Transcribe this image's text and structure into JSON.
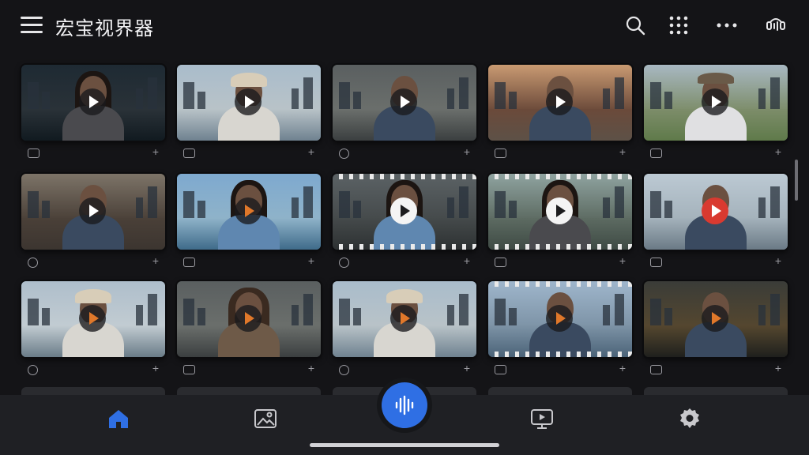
{
  "app": {
    "title": "宏宝视界器"
  },
  "header": {
    "icons": [
      "menu-icon",
      "search-icon",
      "apps-grid-icon",
      "more-icon",
      "voice-assistant-icon"
    ]
  },
  "grid": {
    "rows": [
      [
        {
          "scene": "dark-city",
          "person": "long-hair-woman",
          "play": "dark",
          "meta_icon": "square",
          "action": "+"
        },
        {
          "scene": "cloudy-harbor",
          "person": "bucket-hat-man",
          "play": "dark",
          "meta_icon": "square",
          "action": "+"
        },
        {
          "scene": "office-interior",
          "person": "man",
          "play": "dark",
          "meta_icon": "round",
          "action": "+"
        },
        {
          "scene": "sunset-city",
          "person": "man",
          "play": "dark",
          "meta_icon": "square",
          "action": "+"
        },
        {
          "scene": "green-hills",
          "person": "cap-man",
          "play": "dark",
          "meta_icon": "square",
          "action": "+"
        }
      ],
      [
        {
          "scene": "old-street",
          "person": "man",
          "play": "dark",
          "meta_icon": "round",
          "action": "+"
        },
        {
          "scene": "sky-city",
          "person": "woman",
          "play": "dark-orange",
          "meta_icon": "square",
          "action": "+"
        },
        {
          "scene": "film-dark",
          "person": "woman",
          "play": "white",
          "meta_icon": "round",
          "action": "+"
        },
        {
          "scene": "film-green",
          "person": "long-hair-woman",
          "play": "white",
          "meta_icon": "square",
          "action": "+"
        },
        {
          "scene": "skyline",
          "person": "man",
          "play": "red",
          "meta_icon": "square",
          "action": "+"
        }
      ],
      [
        {
          "scene": "bay-city",
          "person": "bucket-hat-man",
          "play": "dark-orange",
          "meta_icon": "round",
          "action": "+"
        },
        {
          "scene": "office-interior",
          "person": "curly-woman",
          "play": "dark-orange",
          "meta_icon": "square",
          "action": "+"
        },
        {
          "scene": "cloudy-harbor",
          "person": "bucket-hat-man",
          "play": "dark-orange",
          "meta_icon": "round",
          "action": "+"
        },
        {
          "scene": "skyline-film",
          "person": "man",
          "play": "dark-orange",
          "meta_icon": "square",
          "action": "+"
        },
        {
          "scene": "night-street",
          "person": "man",
          "play": "dark-orange",
          "meta_icon": "square",
          "action": "+"
        }
      ]
    ]
  },
  "bottom_nav": {
    "items": [
      "home-icon",
      "gallery-icon",
      "voice-wave-icon",
      "tv-cast-icon",
      "settings-icon"
    ],
    "active": "home-icon",
    "accent_color": "#2f6fe4"
  }
}
